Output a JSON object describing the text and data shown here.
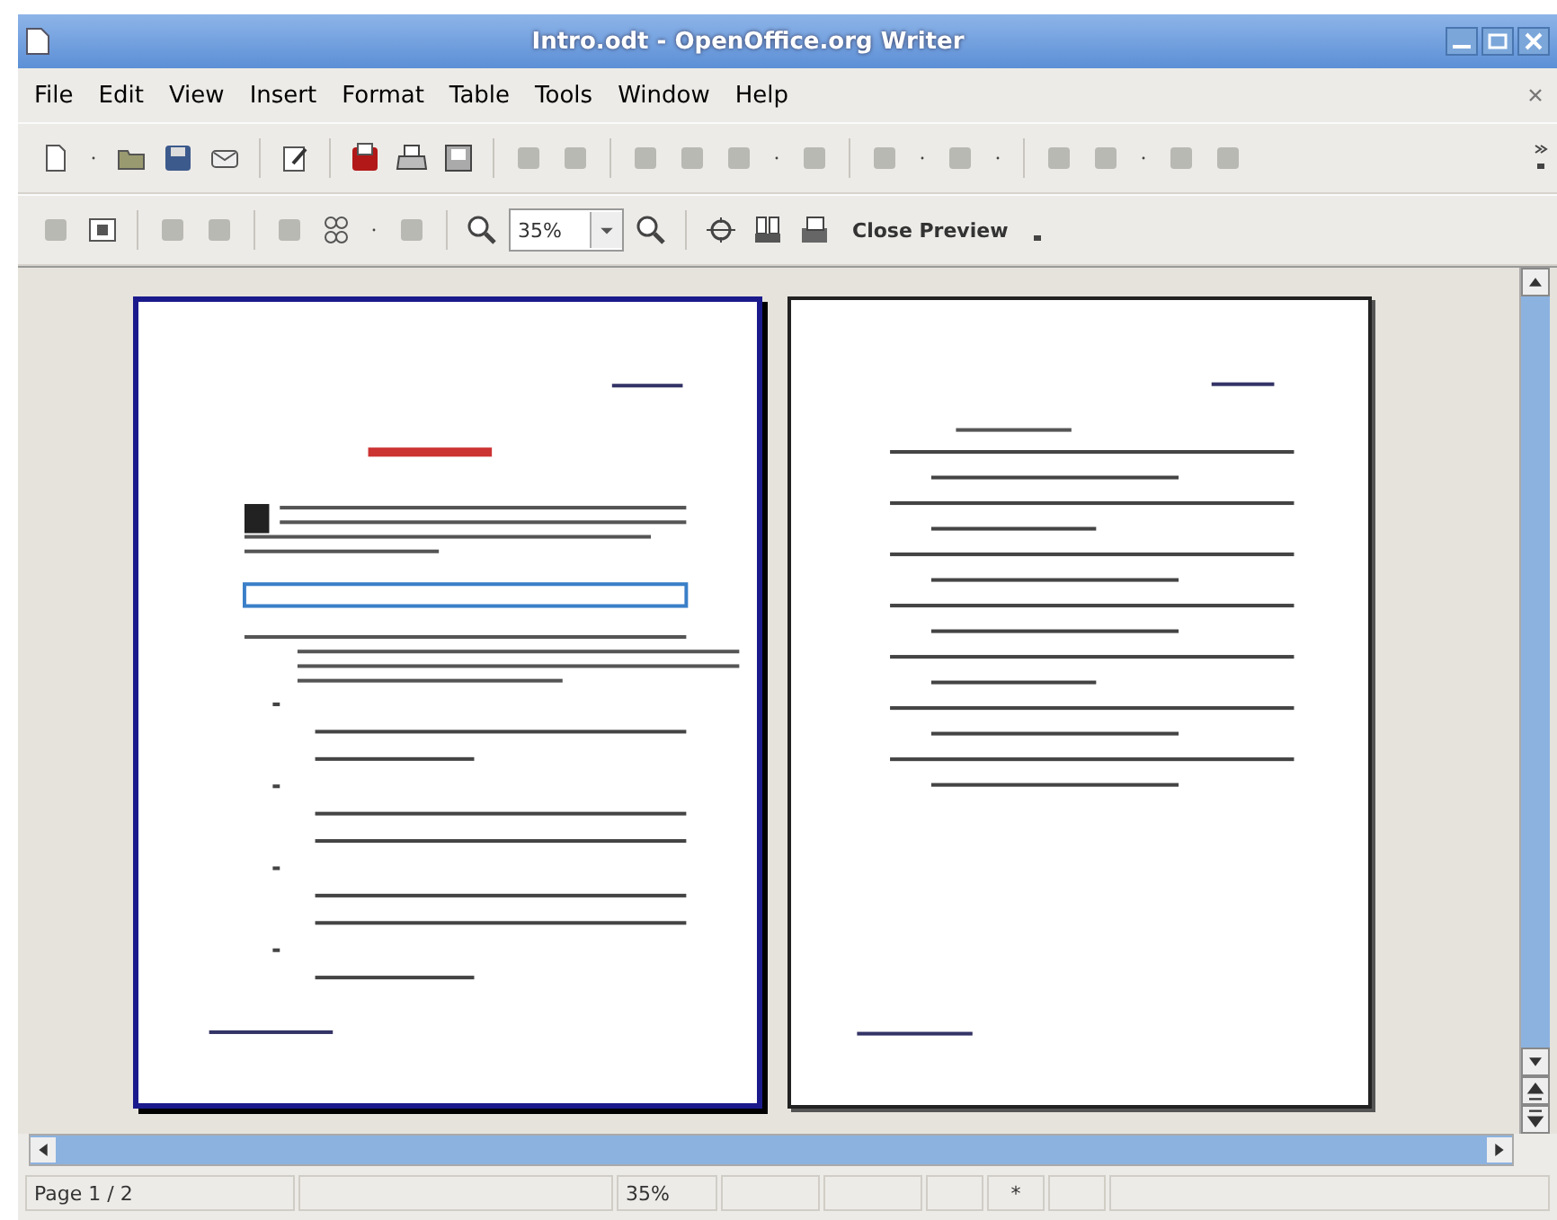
{
  "window": {
    "title": "Intro.odt - OpenOffice.org Writer"
  },
  "menu": [
    "File",
    "Edit",
    "View",
    "Insert",
    "Format",
    "Table",
    "Tools",
    "Window",
    "Help"
  ],
  "preview_toolbar": {
    "zoom_field": {
      "value": "35%"
    },
    "close_button": "Close Preview"
  },
  "pages": [
    {
      "selected": true
    },
    {
      "selected": false
    }
  ],
  "status_bar": {
    "page": "Page 1 / 2",
    "zoom": "35%",
    "modified": "*"
  }
}
